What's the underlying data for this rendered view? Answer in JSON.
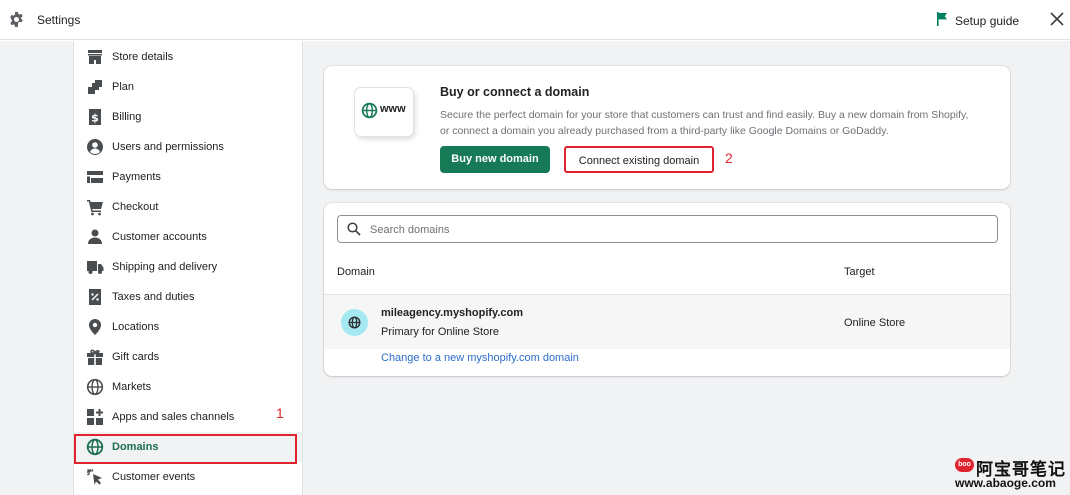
{
  "topbar": {
    "title": "Settings",
    "setup_guide": "Setup guide",
    "colors": {
      "flag": "#008060"
    }
  },
  "sidebar": {
    "items": [
      {
        "label": "Store details",
        "icon": "store-icon"
      },
      {
        "label": "Plan",
        "icon": "plan-icon"
      },
      {
        "label": "Billing",
        "icon": "billing-icon"
      },
      {
        "label": "Users and permissions",
        "icon": "user-icon"
      },
      {
        "label": "Payments",
        "icon": "payments-icon"
      },
      {
        "label": "Checkout",
        "icon": "cart-icon"
      },
      {
        "label": "Customer accounts",
        "icon": "customer-icon"
      },
      {
        "label": "Shipping and delivery",
        "icon": "truck-icon"
      },
      {
        "label": "Taxes and duties",
        "icon": "tax-icon"
      },
      {
        "label": "Locations",
        "icon": "location-icon"
      },
      {
        "label": "Gift cards",
        "icon": "gift-icon"
      },
      {
        "label": "Markets",
        "icon": "globe-icon"
      },
      {
        "label": "Apps and sales channels",
        "icon": "apps-icon"
      },
      {
        "label": "Domains",
        "icon": "domains-globe-icon",
        "active": true
      },
      {
        "label": "Customer events",
        "icon": "cursor-click-icon"
      }
    ]
  },
  "annotations": {
    "step1": "1",
    "step2": "2",
    "highlight_color": "#e0242f"
  },
  "buy_card": {
    "tile_text": "www",
    "title": "Buy or connect a domain",
    "description": "Secure the perfect domain for your store that customers can trust and find easily. Buy a new domain from Shopify, or connect a domain you already purchased from a third-party like Google Domains or GoDaddy.",
    "buy_label": "Buy new domain",
    "connect_label": "Connect existing domain",
    "primary_color": "#157a55"
  },
  "domains_card": {
    "search_placeholder": "Search domains",
    "col_domain": "Domain",
    "col_target": "Target",
    "rows": [
      {
        "domain": "mileagency.myshopify.com",
        "subtitle": "Primary for Online Store",
        "target": "Online Store"
      }
    ],
    "change_link": "Change to a new myshopify.com domain"
  },
  "watermark": {
    "badge": "boo",
    "cn": "阿宝哥笔记",
    "url": "www.abaoge.com"
  }
}
